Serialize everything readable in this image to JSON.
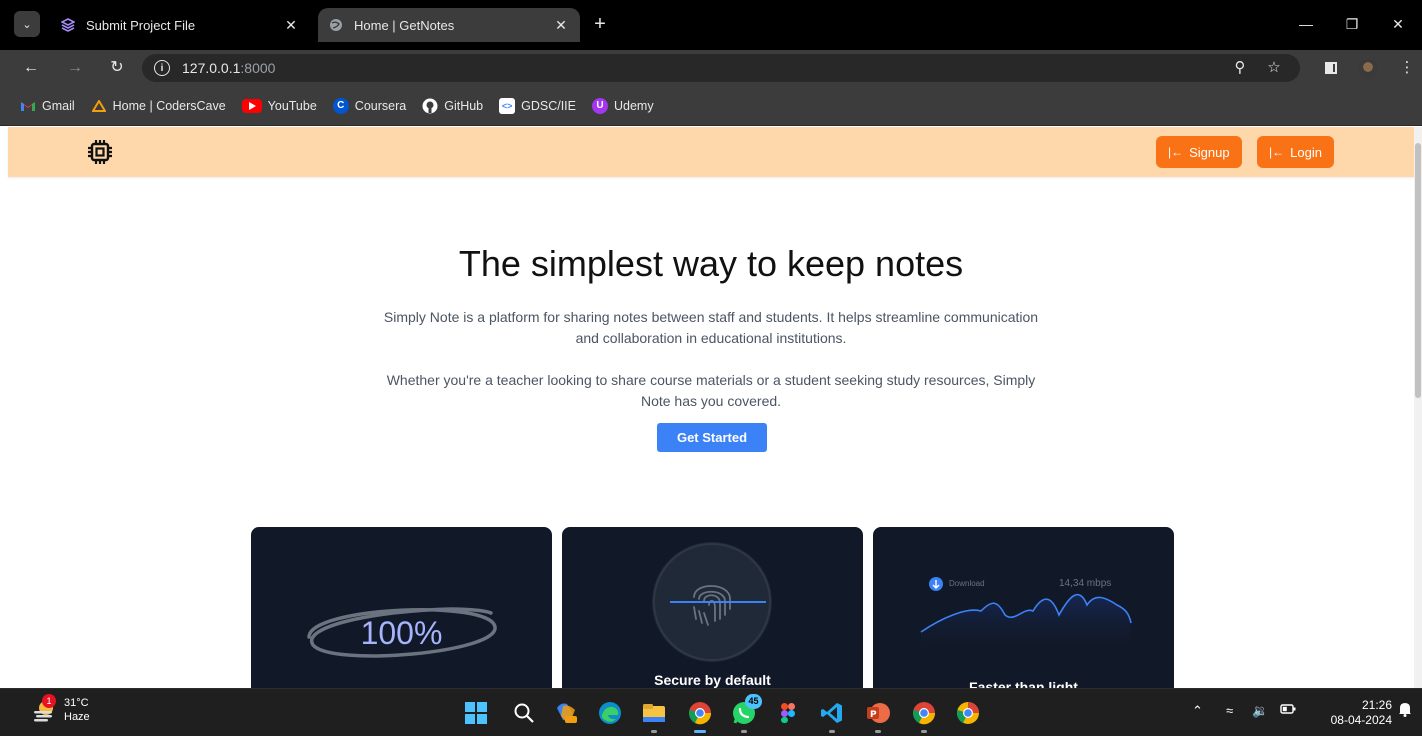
{
  "browser": {
    "tabs": [
      {
        "title": "Submit Project File",
        "active": false
      },
      {
        "title": "Home | GetNotes",
        "active": true
      }
    ],
    "url_host": "127.0.0.1",
    "url_port": ":8000",
    "bookmarks": [
      {
        "label": "Gmail",
        "icon": "gmail-icon"
      },
      {
        "label": "Home | CodersCave",
        "icon": "coderscave-icon"
      },
      {
        "label": "YouTube",
        "icon": "youtube-icon"
      },
      {
        "label": "Coursera",
        "icon": "coursera-icon"
      },
      {
        "label": "GitHub",
        "icon": "github-icon"
      },
      {
        "label": "GDSC/IIE",
        "icon": "gdsc-icon"
      },
      {
        "label": "Udemy",
        "icon": "udemy-icon"
      }
    ]
  },
  "site": {
    "nav": {
      "signup_label": "Signup",
      "login_label": "Login"
    },
    "hero": {
      "title": "The simplest way to keep notes",
      "paragraph1": "Simply Note is a platform for sharing notes between staff and students. It helps streamline communication and collaboration in educational institutions.",
      "paragraph2": "Whether you're a teacher looking to share course materials or a student seeking study resources, Simply Note has you covered.",
      "cta_label": "Get Started"
    },
    "cards": [
      {
        "big_text": "100%",
        "title": ""
      },
      {
        "title": "Secure by default"
      },
      {
        "title": "Faster than light",
        "download_label": "Download",
        "speed": "14,34 mbps"
      }
    ]
  },
  "taskbar": {
    "weather": {
      "temp": "31°C",
      "condition": "Haze",
      "badge": "1"
    },
    "whatsapp_count": "45",
    "time": "21:26",
    "date": "08-04-2024"
  },
  "colors": {
    "nav_bg": "#fed7aa",
    "nav_button": "#f97316",
    "cta": "#3b82f6",
    "card_bg": "#111827"
  }
}
